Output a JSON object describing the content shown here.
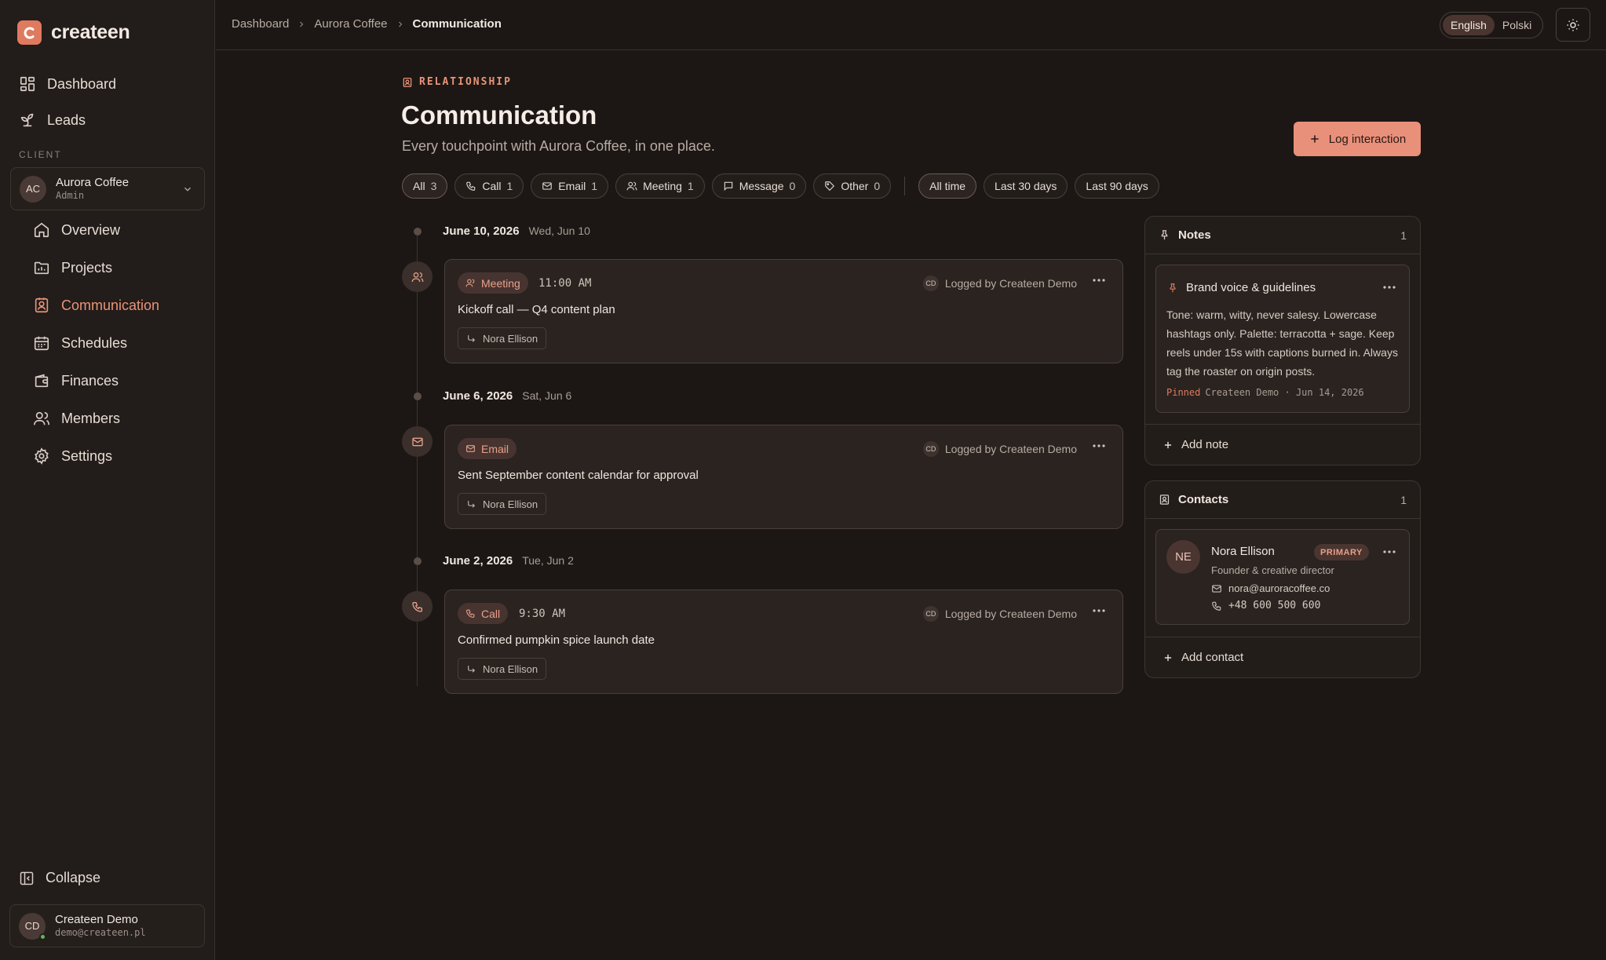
{
  "app": {
    "name": "createen"
  },
  "sidebar": {
    "top_items": [
      {
        "label": "Dashboard",
        "icon": "dashboard-icon"
      },
      {
        "label": "Leads",
        "icon": "sprout-icon"
      }
    ],
    "client_section_label": "CLIENT",
    "client": {
      "initials": "AC",
      "name": "Aurora Coffee",
      "role": "Admin"
    },
    "client_items": [
      {
        "label": "Overview",
        "icon": "home-icon"
      },
      {
        "label": "Projects",
        "icon": "folder-icon"
      },
      {
        "label": "Communication",
        "icon": "contact-book-icon",
        "active": true
      },
      {
        "label": "Schedules",
        "icon": "calendar-icon"
      },
      {
        "label": "Finances",
        "icon": "wallet-icon"
      },
      {
        "label": "Members",
        "icon": "users-icon"
      },
      {
        "label": "Settings",
        "icon": "gear-icon"
      }
    ],
    "collapse_label": "Collapse",
    "user": {
      "initials": "CD",
      "name": "Createen Demo",
      "email": "demo@createen.pl"
    }
  },
  "breadcrumb": [
    "Dashboard",
    "Aurora Coffee",
    "Communication"
  ],
  "language": {
    "options": [
      "English",
      "Polski"
    ],
    "selected": "English"
  },
  "header": {
    "eyebrow": "RELATIONSHIP",
    "title": "Communication",
    "subtitle": "Every touchpoint with Aurora Coffee, in one place.",
    "log_button": "Log interaction"
  },
  "filters": {
    "types": [
      {
        "label": "All",
        "count": "3",
        "icon": ""
      },
      {
        "label": "Call",
        "count": "1",
        "icon": "phone-icon"
      },
      {
        "label": "Email",
        "count": "1",
        "icon": "mail-icon"
      },
      {
        "label": "Meeting",
        "count": "1",
        "icon": "users-icon"
      },
      {
        "label": "Message",
        "count": "0",
        "icon": "message-icon"
      },
      {
        "label": "Other",
        "count": "0",
        "icon": "tag-icon"
      }
    ],
    "ranges": [
      "All time",
      "Last 30 days",
      "Last 90 days"
    ]
  },
  "timeline": [
    {
      "date": "June 10, 2026",
      "weekday": "Wed, Jun 10",
      "type": "Meeting",
      "time": "11:00 AM",
      "logged_initials": "CD",
      "logged_by": "Logged by Createen Demo",
      "title": "Kickoff call — Q4 content plan",
      "contact": "Nora Ellison"
    },
    {
      "date": "June 6, 2026",
      "weekday": "Sat, Jun 6",
      "type": "Email",
      "time": "",
      "logged_initials": "CD",
      "logged_by": "Logged by Createen Demo",
      "title": "Sent September content calendar for approval",
      "contact": "Nora Ellison"
    },
    {
      "date": "June 2, 2026",
      "weekday": "Tue, Jun 2",
      "type": "Call",
      "time": "9:30 AM",
      "logged_initials": "CD",
      "logged_by": "Logged by Createen Demo",
      "title": "Confirmed pumpkin spice launch date",
      "contact": "Nora Ellison"
    }
  ],
  "notes": {
    "title": "Notes",
    "count": "1",
    "items": [
      {
        "title": "Brand voice & guidelines",
        "body": "Tone: warm, witty, never salesy. Lowercase hashtags only. Palette: terracotta + sage. Keep reels under 15s with captions burned in. Always tag the roaster on origin posts.",
        "pinned": "Pinned",
        "meta": "Createen Demo · Jun 14, 2026"
      }
    ],
    "add_label": "Add note"
  },
  "contacts": {
    "title": "Contacts",
    "count": "1",
    "items": [
      {
        "initials": "NE",
        "name": "Nora Ellison",
        "badge": "PRIMARY",
        "role": "Founder & creative director",
        "email": "nora@auroracoffee.co",
        "phone": "+48 600 500 600"
      }
    ],
    "add_label": "Add contact"
  },
  "colors": {
    "accent": "#e8907a",
    "background": "#1c1715",
    "sidebar": "#221c1a"
  }
}
